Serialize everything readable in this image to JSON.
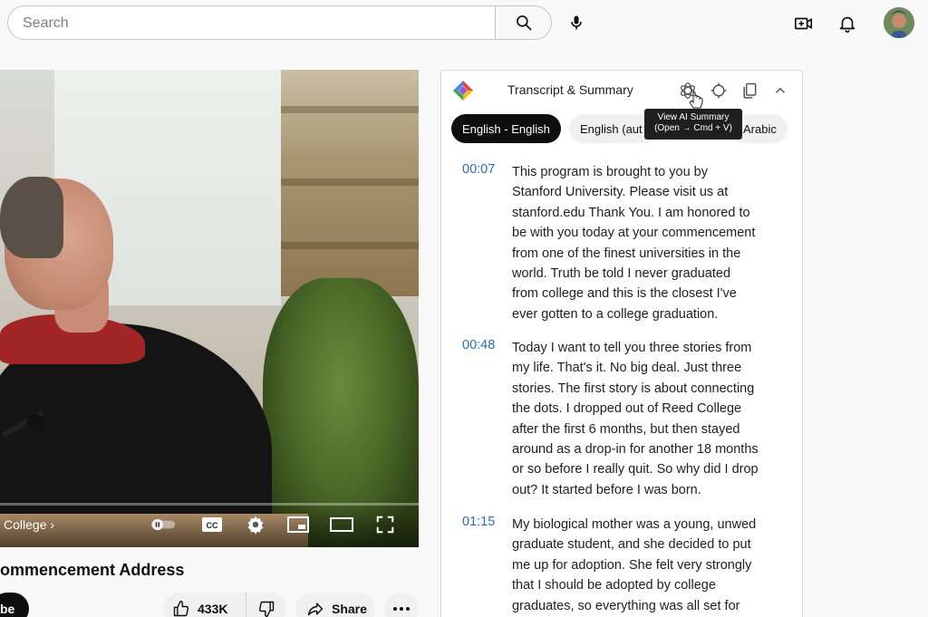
{
  "search": {
    "placeholder": "Search"
  },
  "icons": {
    "search": "search-icon",
    "mic": "microphone-icon",
    "create": "video-camera-plus-icon",
    "notifications": "bell-icon",
    "avatar": "user-avatar"
  },
  "player": {
    "chapter_label": "College",
    "progress_fraction": 0.0,
    "controls": [
      "autoplay-toggle",
      "captions",
      "settings",
      "miniplayer",
      "theater-mode",
      "fullscreen"
    ]
  },
  "video": {
    "title": "ommencement Address",
    "subscribe_label": "be",
    "like_count": "433K",
    "share_label": "Share"
  },
  "panel": {
    "title": "Transcript & Summary",
    "tooltip_line1": "View AI Summary",
    "tooltip_line2": "(Open → Cmd + V)",
    "languages": [
      {
        "label": "English - English",
        "active": true
      },
      {
        "label": "English (aut",
        "active": false
      },
      {
        "label": "Arabic",
        "active": false
      }
    ],
    "entries": [
      {
        "time": "00:07",
        "lines": [
          "This program is brought to you by",
          "Stanford University. Please visit us at",
          "stanford.edu Thank You. I am honored to",
          "be with you today at your commencement",
          "from one of the finest universities in the",
          "world. Truth be told I never graduated",
          "from college and this is the closest I've",
          "ever gotten to a college graduation."
        ]
      },
      {
        "time": "00:48",
        "lines": [
          "Today I want to tell you three stories from",
          "my life. That's it. No big deal. Just three",
          "stories. The first story is about connecting",
          "the dots. I dropped out of Reed College",
          "after the first 6 months, but then stayed",
          "around as a drop-in for another 18 months",
          "or so before I really quit. So why did I drop",
          "out? It started before I was born."
        ]
      },
      {
        "time": "01:15",
        "lines": [
          "My biological mother was a young, unwed",
          "graduate student, and she decided to put",
          "me up for adoption. She felt very strongly",
          "that I should be adopted by college",
          "graduates, so everything was all set for"
        ]
      }
    ]
  },
  "colors": {
    "timestamp": "#2a6dbb",
    "accent_red": "#ff0000",
    "pill_active": "#0f0f0f"
  }
}
